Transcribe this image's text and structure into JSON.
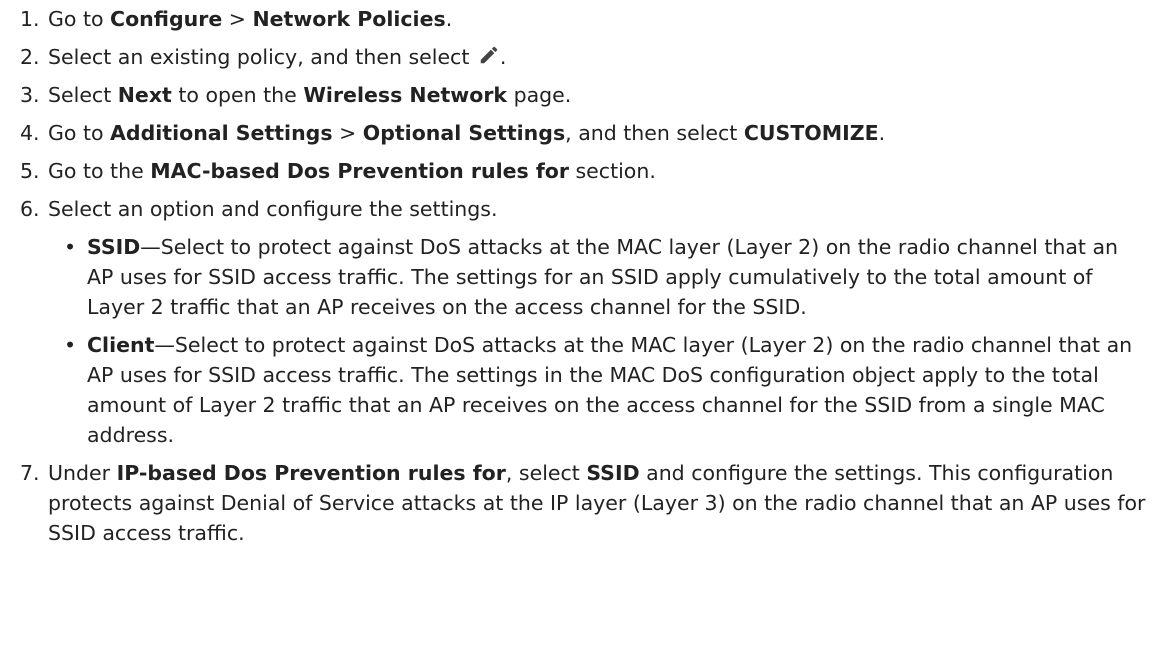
{
  "steps": [
    {
      "num": "1.",
      "parts": [
        {
          "t": "Go to "
        },
        {
          "t": "Configure",
          "b": true
        },
        {
          "t": " > "
        },
        {
          "t": "Network Policies",
          "b": true
        },
        {
          "t": "."
        }
      ]
    },
    {
      "num": "2.",
      "parts": [
        {
          "t": "Select an existing policy, and then select "
        },
        {
          "icon": "pencil-edit-icon"
        },
        {
          "t": "."
        }
      ]
    },
    {
      "num": "3.",
      "parts": [
        {
          "t": "Select "
        },
        {
          "t": "Next",
          "b": true
        },
        {
          "t": " to open the "
        },
        {
          "t": "Wireless Network",
          "b": true
        },
        {
          "t": " page."
        }
      ]
    },
    {
      "num": "4.",
      "parts": [
        {
          "t": "Go to "
        },
        {
          "t": "Additional Settings",
          "b": true
        },
        {
          "t": " > "
        },
        {
          "t": "Optional Settings",
          "b": true
        },
        {
          "t": ", and then select "
        },
        {
          "t": "CUSTOMIZE",
          "b": true
        },
        {
          "t": "."
        }
      ]
    },
    {
      "num": "5.",
      "parts": [
        {
          "t": "Go to the "
        },
        {
          "t": "MAC-based Dos Prevention rules for",
          "b": true
        },
        {
          "t": " section."
        }
      ]
    },
    {
      "num": "6.",
      "parts": [
        {
          "t": "Select an option and configure the settings."
        }
      ],
      "subs": [
        {
          "parts": [
            {
              "t": "SSID",
              "b": true
            },
            {
              "t": "—Select to protect against DoS attacks at the MAC layer (Layer 2) on the radio channel that an AP uses for SSID access traffic. The settings for an SSID apply cumulatively to the total amount of Layer 2 traffic that an AP receives on the access channel for the SSID."
            }
          ]
        },
        {
          "parts": [
            {
              "t": "Client",
              "b": true
            },
            {
              "t": "—Select to protect against DoS attacks at the MAC layer (Layer 2) on the radio channel that an AP uses for SSID access traffic. The settings in the MAC DoS configuration object apply to the total amount of Layer 2 traffic that an AP receives on the access channel for the SSID from a single MAC address."
            }
          ]
        }
      ]
    },
    {
      "num": "7.",
      "parts": [
        {
          "t": "Under "
        },
        {
          "t": "IP-based Dos Prevention rules for",
          "b": true
        },
        {
          "t": ", select "
        },
        {
          "t": "SSID",
          "b": true
        },
        {
          "t": " and configure the settings. This configuration protects against Denial of Service attacks at the IP layer (Layer 3) on the radio channel that an AP uses for SSID access traffic."
        }
      ]
    }
  ],
  "bullet_char": "•",
  "colors": {
    "text": "#222222",
    "icon": "#444444",
    "background": "#ffffff"
  }
}
